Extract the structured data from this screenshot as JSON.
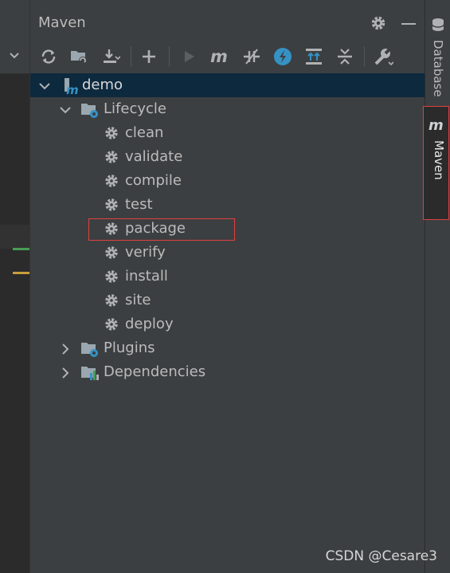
{
  "panel": {
    "title": "Maven"
  },
  "toolbar": [
    {
      "name": "reload-icon"
    },
    {
      "name": "add-project-icon"
    },
    {
      "name": "download-icon"
    },
    {
      "name": "add-icon"
    },
    {
      "name": "run-icon"
    },
    {
      "name": "maven-goal-icon"
    },
    {
      "name": "toggle-offline-icon"
    },
    {
      "name": "skip-tests-icon"
    },
    {
      "name": "show-dependencies-icon"
    },
    {
      "name": "collapse-all-icon"
    },
    {
      "name": "settings-wrench-icon"
    }
  ],
  "tree": {
    "project": "demo",
    "lifecycle": {
      "label": "Lifecycle",
      "goals": [
        "clean",
        "validate",
        "compile",
        "test",
        "package",
        "verify",
        "install",
        "site",
        "deploy"
      ]
    },
    "plugins": "Plugins",
    "dependencies": "Dependencies"
  },
  "right_bar": {
    "database": "Database",
    "maven": "Maven"
  },
  "watermark": "CSDN @Cesare3",
  "colors": {
    "background": "#3c3f41",
    "selection": "#0d293e",
    "highlight": "#e04040",
    "accent": "#3592c4"
  }
}
